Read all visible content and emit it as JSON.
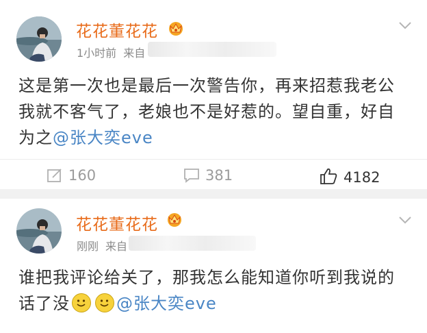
{
  "posts": [
    {
      "author": "花花董花花",
      "time": "1小时前",
      "source_prefix": "来自",
      "text": "这是第一次也是最后一次警告你，再来招惹我老公我就不客气了，老娘也不是好惹的。望自重，好自为之",
      "mention": "@张大奕eve",
      "reposts": "160",
      "comments": "381",
      "likes": "4182"
    },
    {
      "author": "花花董花花",
      "time": "刚刚",
      "source_prefix": "来自",
      "text": "谁把我评论给关了，那我怎么能知道你听到我说的话了没",
      "emojis": [
        "smile-emoji",
        "smile-emoji"
      ],
      "mention": "@张大奕eve"
    }
  ],
  "colors": {
    "author": "#e86b1a",
    "mention": "#4a86c5",
    "meta": "#8a8a8a",
    "action": "#9b9b9b"
  },
  "icons": [
    "avatar-photo",
    "vip-crown-icon",
    "chevron-down-icon",
    "repost-icon",
    "comment-icon",
    "like-icon",
    "smile-emoji"
  ]
}
